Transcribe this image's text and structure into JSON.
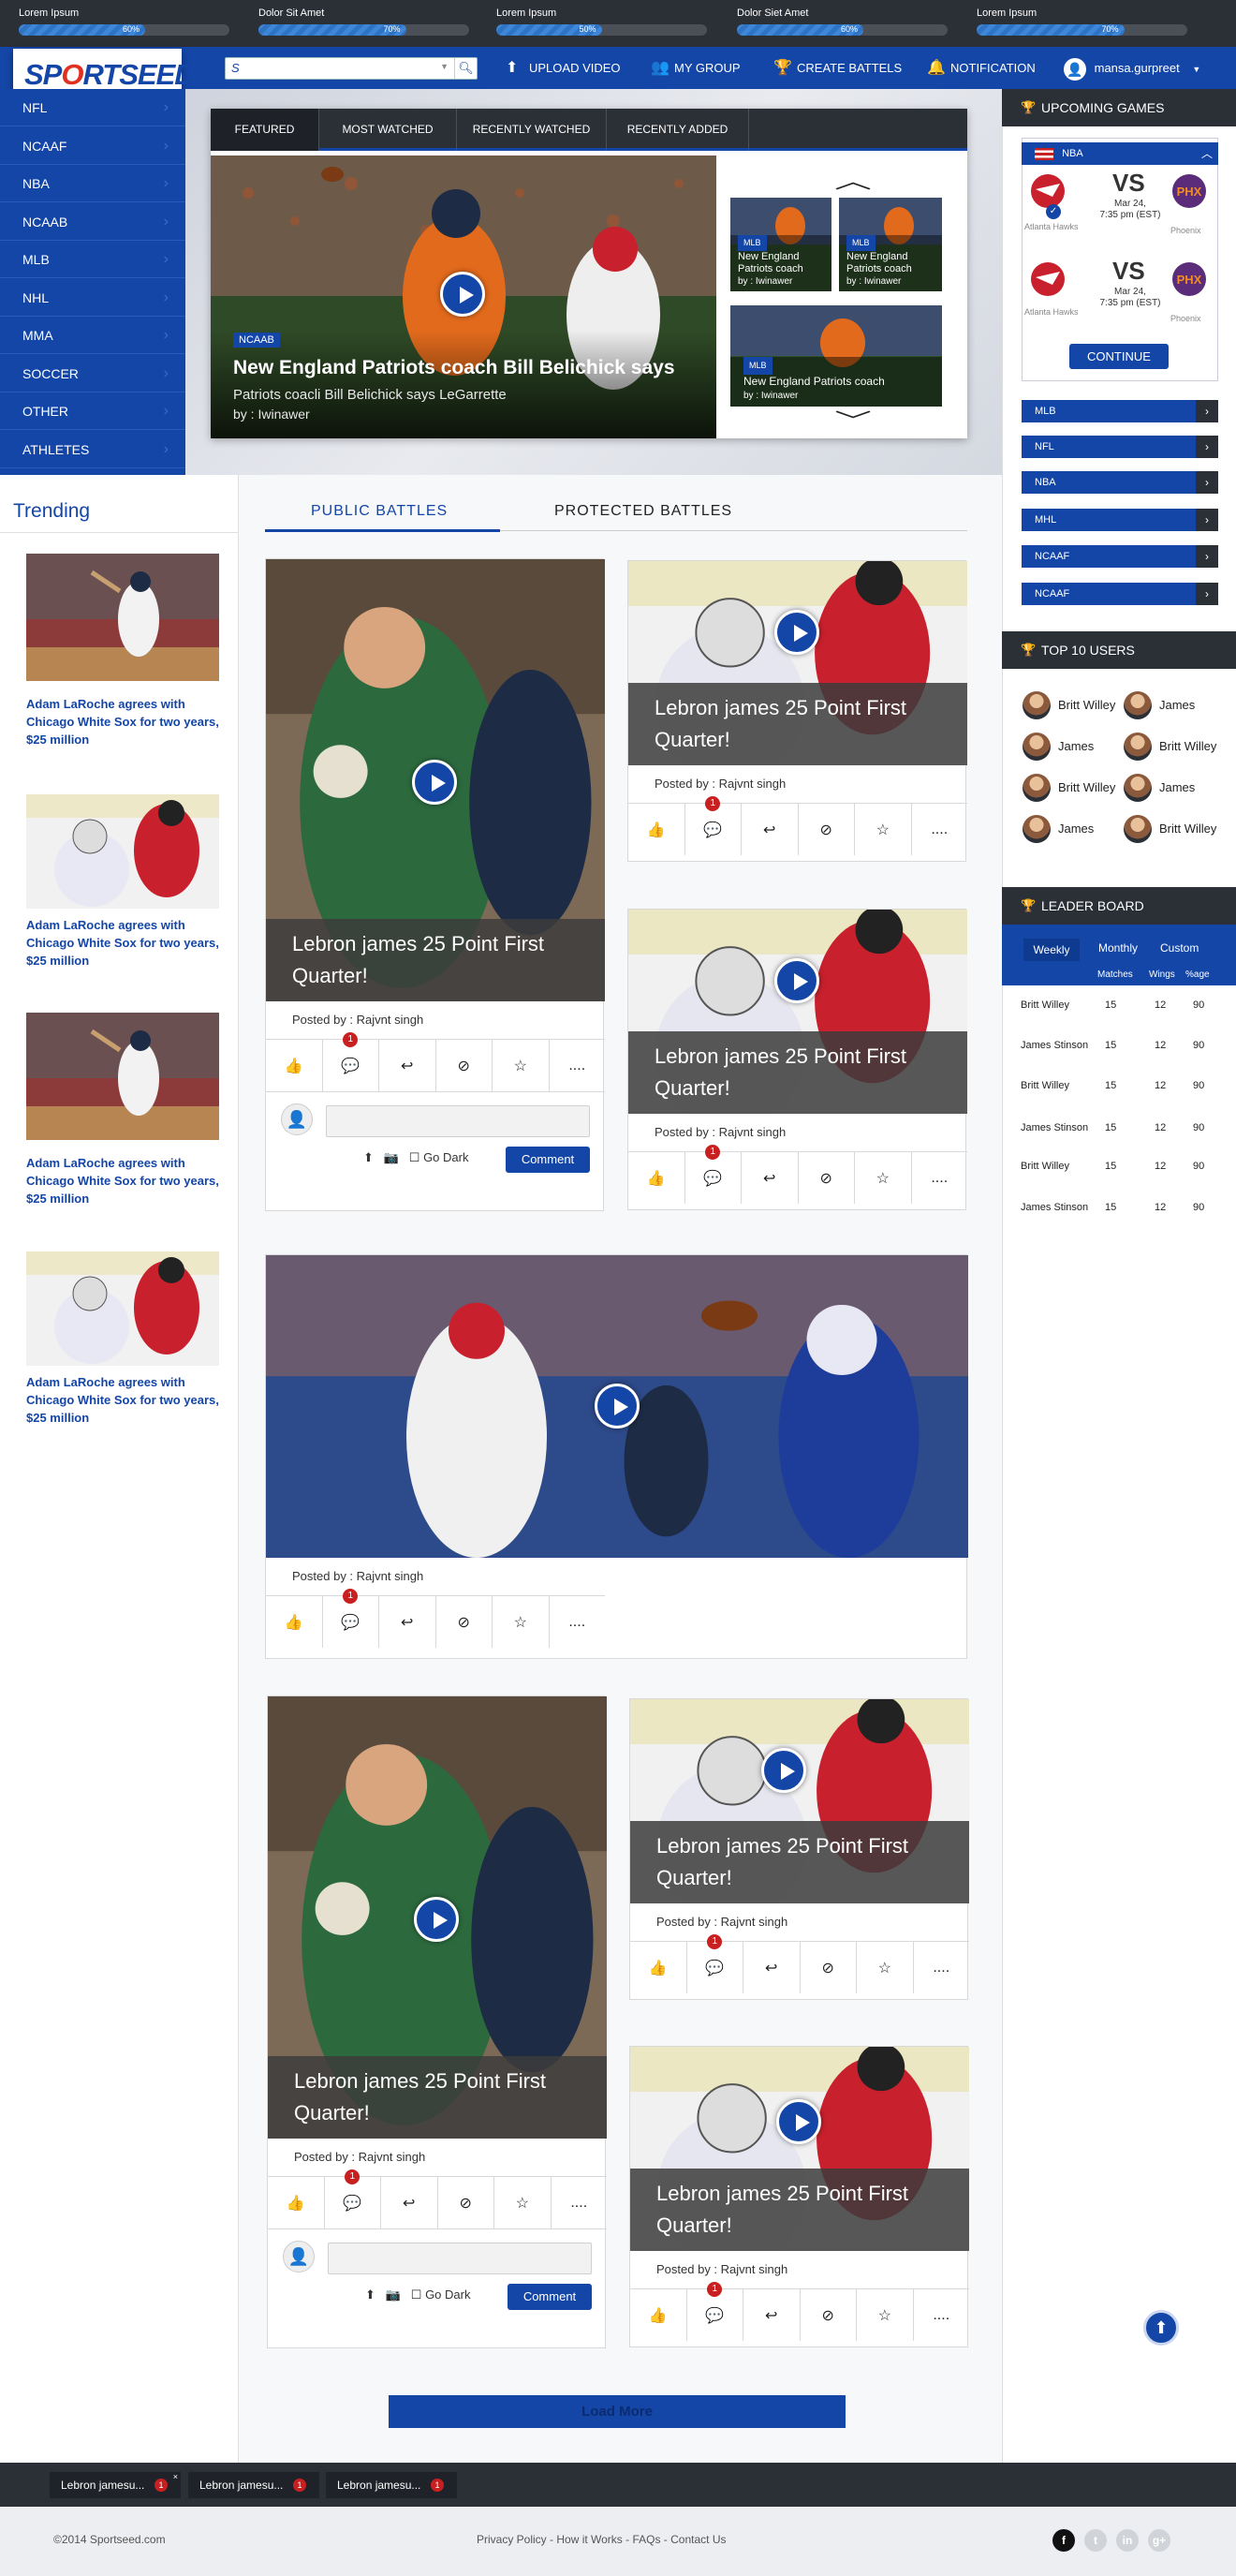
{
  "ticker": [
    {
      "name": "Lorem Ipsum",
      "pct": "60%",
      "value": 0.6
    },
    {
      "name": "Dolor Sit Amet",
      "pct": "70%",
      "value": 0.7
    },
    {
      "name": "Lorem Ipsum",
      "pct": "50%",
      "value": 0.5
    },
    {
      "name": "Dolor Siet Amet",
      "pct": "60%",
      "value": 0.6
    },
    {
      "name": "Lorem Ipsum",
      "pct": "70%",
      "value": 0.7
    }
  ],
  "header": {
    "logo_a": "SP",
    "logo_b": "O",
    "logo_c": "RTSEED",
    "search_prefix": "S",
    "nav": {
      "upload": "UPLOAD VIDEO",
      "group": "MY GROUP",
      "battles": "CREATE BATTELS",
      "notification": "NOTIFICATION",
      "user": "mansa.gurpreet"
    }
  },
  "sidebar": [
    "NFL",
    "NCAAF",
    "NBA",
    "NCAAB",
    "MLB",
    "NHL",
    "MMA",
    "SOCCER",
    "OTHER",
    "ATHLETES"
  ],
  "hero": {
    "tabs": [
      "FEATURED",
      "MOST WATCHED",
      "RECENTLY WATCHED",
      "RECENTLY ADDED"
    ],
    "tag": "NCAAB",
    "title": "New England Patriots coach Bill Belichick says",
    "subtitle": "Patriots coacli Bill Belichick says LeGarrette",
    "by": "by : Iwinawer",
    "thumbs": [
      {
        "tag": "MLB",
        "title": "New England Patriots coach",
        "by": "by : Iwinawer"
      },
      {
        "tag": "MLB",
        "title": "New England Patriots coach",
        "by": "by : Iwinawer"
      },
      {
        "tag": "MLB",
        "title": "New England Patriots coach",
        "by": "by : Iwinawer"
      }
    ]
  },
  "upcoming": {
    "title": "UPCOMING GAMES",
    "league": "NBA",
    "games": [
      {
        "home": "Atlanta Hawks",
        "away": "Phoenix",
        "vs": "VS",
        "date": "Mar 24,",
        "time": "7:35 pm (EST)"
      },
      {
        "home": "Atlanta Hawks",
        "away": "Phoenix",
        "vs": "VS",
        "date": "Mar 24,",
        "time": "7:35 pm (EST)"
      }
    ],
    "continue": "CONTINUE",
    "categories": [
      "MLB",
      "NFL",
      "NBA",
      "MHL",
      "NCAAF",
      "NCAAF"
    ]
  },
  "top_users": {
    "title": "TOP 10 USERS",
    "rows": [
      [
        "Britt Willey",
        "James"
      ],
      [
        "James",
        "Britt Willey"
      ],
      [
        "Britt Willey",
        "James"
      ],
      [
        "James",
        "Britt Willey"
      ]
    ]
  },
  "leaderboard": {
    "title": "LEADER BOARD",
    "tabs": [
      "Weekly",
      "Monthly",
      "Custom"
    ],
    "cols": [
      "Matches",
      "Wings",
      "%age"
    ],
    "rows": [
      [
        "Britt Willey",
        "15",
        "12",
        "90"
      ],
      [
        "James Stinson",
        "15",
        "12",
        "90"
      ],
      [
        "Britt Willey",
        "15",
        "12",
        "90"
      ],
      [
        "James Stinson",
        "15",
        "12",
        "90"
      ],
      [
        "Britt Willey",
        "15",
        "12",
        "90"
      ],
      [
        "James Stinson",
        "15",
        "12",
        "90"
      ]
    ]
  },
  "trending": {
    "title": "Trending",
    "items": [
      "Adam LaRoche agrees with Chicago White Sox for two years, $25 million",
      "Adam LaRoche agrees with Chicago White Sox for two years, $25 million",
      "Adam LaRoche agrees with Chicago White Sox for two years, $25 million",
      "Adam LaRoche agrees with Chicago White Sox for two years, $25 million"
    ]
  },
  "battles": {
    "tabs": [
      "PUBLIC  BATTLES",
      "PROTECTED  BATTLES"
    ],
    "card_title": "Lebron james 25 Point First Quarter!",
    "posted": "Posted by : Rajvnt singh",
    "badge": "1",
    "more": "....",
    "go_dark": "Go Dark",
    "comment": "Comment"
  },
  "load_more": "Load More",
  "chat": [
    "Lebron jamesu...",
    "Lebron jamesu...",
    "Lebron jamesu..."
  ],
  "chat_badge": "1",
  "footer": {
    "copyright": "©2014 Sportseed.com",
    "links": "Privacy Policy - How it Works - FAQs - Contact Us",
    "social": [
      "f",
      "t",
      "in",
      "g+"
    ]
  }
}
